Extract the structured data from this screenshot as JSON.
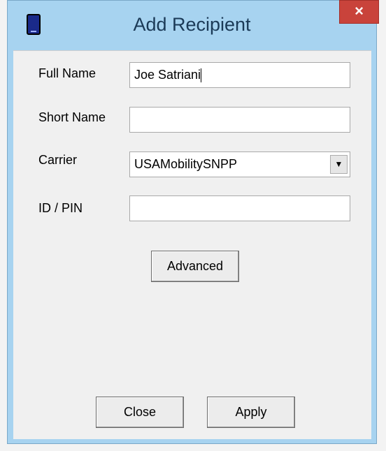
{
  "window": {
    "title": "Add Recipient",
    "close_glyph": "×",
    "icon": "phone-icon"
  },
  "form": {
    "full_name_label": "Full Name",
    "full_name_value": "Joe Satriani",
    "short_name_label": "Short Name",
    "short_name_value": "",
    "carrier_label": "Carrier",
    "carrier_value": "USAMobilitySNPP",
    "carrier_arrow": "▼",
    "id_pin_label": "ID / PIN",
    "id_pin_value": ""
  },
  "buttons": {
    "advanced": "Advanced",
    "close": "Close",
    "apply": "Apply"
  },
  "colors": {
    "frame": "#a7d3f0",
    "close_button": "#c9433b",
    "client": "#f0f0f0"
  }
}
